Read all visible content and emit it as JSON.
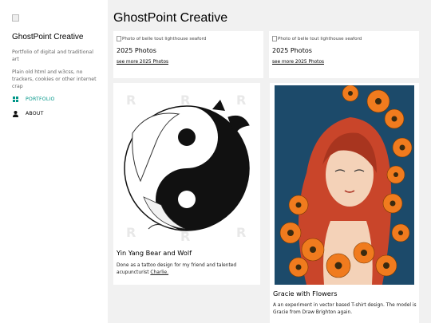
{
  "sidebar": {
    "logo_alt": "",
    "site_title": "GhostPoint Creative",
    "tagline": "Portfolio of digital and traditional art",
    "note": "Plain old html and w3css, no trackers, cookies or other internet crap",
    "nav": [
      {
        "label": "PORTFOLIO",
        "icon": "grid-icon",
        "active": true
      },
      {
        "label": "ABOUT",
        "icon": "user-icon",
        "active": false
      }
    ]
  },
  "main": {
    "title": "GhostPoint Creative",
    "photo_cards": [
      {
        "img_alt": "Photo of belle tout lighthouse seaford",
        "heading": "2025 Photos",
        "link": "see more 2025 Photos"
      },
      {
        "img_alt": "Photo of belle tout lighthouse seaford",
        "heading": "2025 Photos",
        "link": "see more 2025 Photos"
      }
    ],
    "art_cards": [
      {
        "title": "Yin Yang Bear and Wolf",
        "desc": "Done as a tattoo design for my friend and talented acupuncturist ",
        "link": "Charlie."
      },
      {
        "title": "Gracie with Flowers",
        "desc": "A an experiment in vector based T-shirt design. The model is Gracie from Draw Brighton again."
      }
    ]
  },
  "colors": {
    "accent": "#009688",
    "sidebar_bg": "#ffffff",
    "page_bg": "#f1f1f1",
    "art_bg": "#1c4a6a",
    "flower": "#f07b1e",
    "hair": "#c9452a"
  }
}
